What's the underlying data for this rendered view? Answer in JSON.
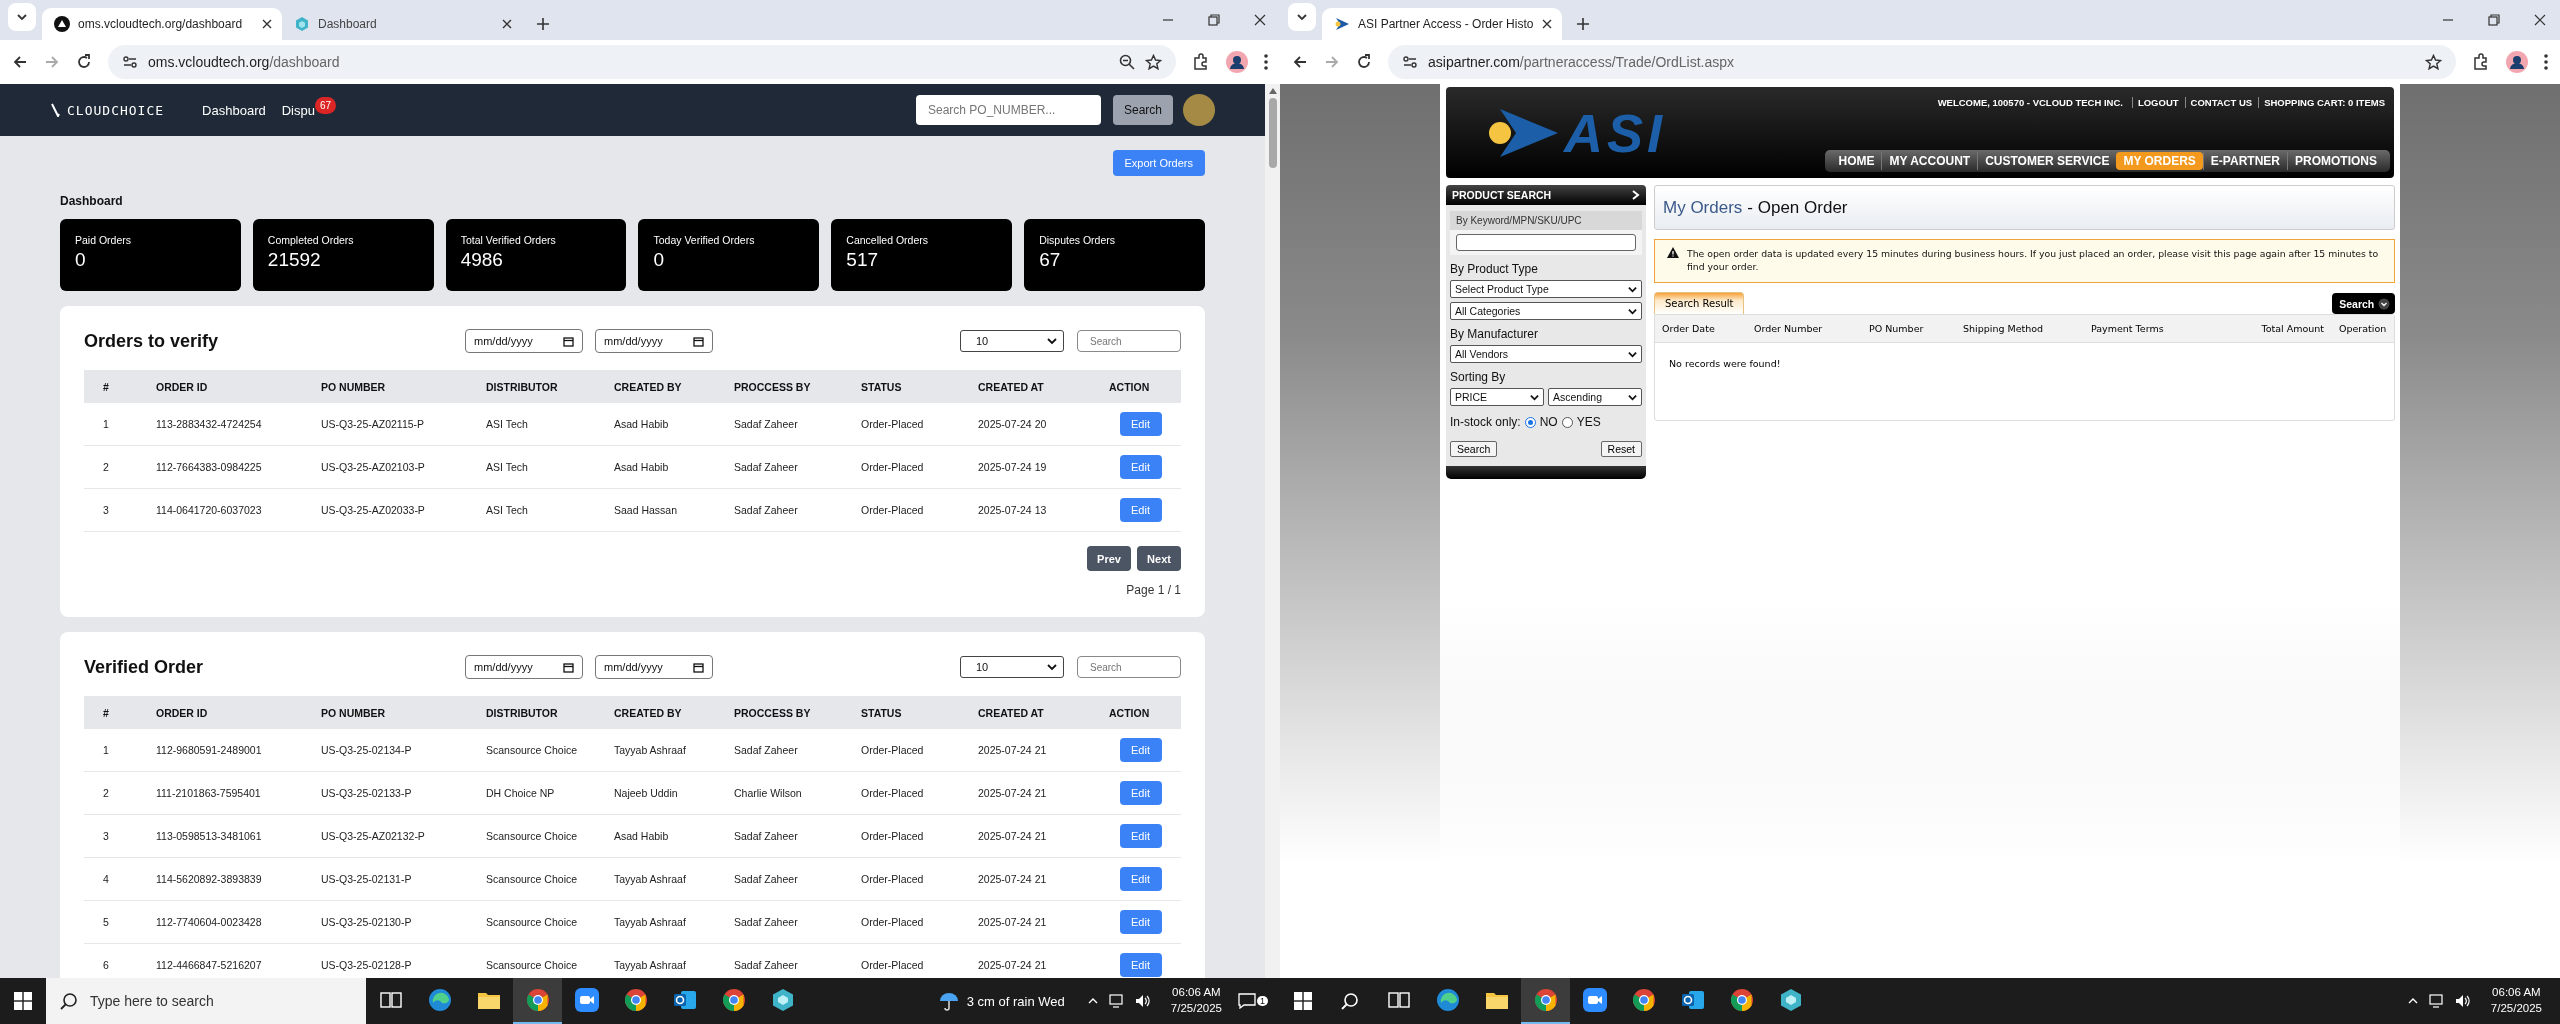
{
  "left_browser": {
    "tabs": [
      {
        "title": "oms.vcloudtech.org/dashboard",
        "kind": "triangle",
        "selected": true
      },
      {
        "title": "Dashboard",
        "kind": "hexagon",
        "selected": false
      }
    ],
    "address": {
      "host": "oms.vcloudtech.org",
      "path": "/dashboard"
    },
    "zoom_indicator": true,
    "page": {
      "logo": "CLOUDCHOICE",
      "nav_links": [
        {
          "label": "Dashboard"
        },
        {
          "label": "Dispu",
          "badge": "67"
        }
      ],
      "search": {
        "placeholder": "Search PO_NUMBER..."
      },
      "search_button": "Search",
      "export_button": "Export Orders",
      "heading": "Dashboard",
      "stats": [
        {
          "label": "Paid Orders",
          "value": "0"
        },
        {
          "label": "Completed Orders",
          "value": "21592"
        },
        {
          "label": "Total Verified Orders",
          "value": "4986"
        },
        {
          "label": "Today Verified Orders",
          "value": "0"
        },
        {
          "label": "Cancelled Orders",
          "value": "517"
        },
        {
          "label": "Disputes Orders",
          "value": "67"
        }
      ],
      "panels": [
        {
          "title": "Orders to verify",
          "date_fields": [
            "mm/dd/yyyy",
            "mm/dd/yyyy"
          ],
          "page_size": "10",
          "search": {
            "placeholder": "Search"
          },
          "columns": [
            "#",
            "ORDER ID",
            "PO NUMBER",
            "DISTRIBUTOR",
            "CREATED BY",
            "PROCCESS BY",
            "STATUS",
            "CREATED AT",
            "ACTION"
          ],
          "rows": [
            {
              "cells": [
                "1",
                "113-2883432-4724254",
                "US-Q3-25-AZ02115-P",
                "ASI Tech",
                "Asad Habib",
                "Sadaf Zaheer",
                "Order-Placed",
                "2025-07-24 20"
              ],
              "action": "Edit"
            },
            {
              "cells": [
                "2",
                "112-7664383-0984225",
                "US-Q3-25-AZ02103-P",
                "ASI Tech",
                "Asad Habib",
                "Sadaf Zaheer",
                "Order-Placed",
                "2025-07-24 19"
              ],
              "action": "Edit"
            },
            {
              "cells": [
                "3",
                "114-0641720-6037023",
                "US-Q3-25-AZ02033-P",
                "ASI Tech",
                "Saad Hassan",
                "Sadaf Zaheer",
                "Order-Placed",
                "2025-07-24 13"
              ],
              "action": "Edit"
            }
          ],
          "pager": {
            "prev": "Prev",
            "next": "Next",
            "status": "Page 1 / 1"
          }
        },
        {
          "title": "Verified Order",
          "date_fields": [
            "mm/dd/yyyy",
            "mm/dd/yyyy"
          ],
          "page_size": "10",
          "search": {
            "placeholder": "Search"
          },
          "columns": [
            "#",
            "ORDER ID",
            "PO NUMBER",
            "DISTRIBUTOR",
            "CREATED BY",
            "PROCCESS BY",
            "STATUS",
            "CREATED AT",
            "ACTION"
          ],
          "rows": [
            {
              "cells": [
                "1",
                "112-9680591-2489001",
                "US-Q3-25-02134-P",
                "Scansource Choice",
                "Tayyab Ashraaf",
                "Sadaf Zaheer",
                "Order-Placed",
                "2025-07-24 21"
              ],
              "action": "Edit"
            },
            {
              "cells": [
                "2",
                "111-2101863-7595401",
                "US-Q3-25-02133-P",
                "DH Choice NP",
                "Najeeb Uddin",
                "Charlie Wilson",
                "Order-Placed",
                "2025-07-24 21"
              ],
              "action": "Edit"
            },
            {
              "cells": [
                "3",
                "113-0598513-3481061",
                "US-Q3-25-AZ02132-P",
                "Scansource Choice",
                "Asad Habib",
                "Sadaf Zaheer",
                "Order-Placed",
                "2025-07-24 21"
              ],
              "action": "Edit"
            },
            {
              "cells": [
                "4",
                "114-5620892-3893839",
                "US-Q3-25-02131-P",
                "Scansource Choice",
                "Tayyab Ashraaf",
                "Sadaf Zaheer",
                "Order-Placed",
                "2025-07-24 21"
              ],
              "action": "Edit"
            },
            {
              "cells": [
                "5",
                "112-7740604-0023428",
                "US-Q3-25-02130-P",
                "Scansource Choice",
                "Tayyab Ashraaf",
                "Sadaf Zaheer",
                "Order-Placed",
                "2025-07-24 21"
              ],
              "action": "Edit"
            },
            {
              "cells": [
                "6",
                "112-4466847-5216207",
                "US-Q3-25-02128-P",
                "Scansource Choice",
                "Tayyab Ashraaf",
                "Sadaf Zaheer",
                "Order-Placed",
                "2025-07-24 21"
              ],
              "action": "Edit"
            }
          ]
        }
      ]
    }
  },
  "right_browser": {
    "tabs": [
      {
        "title": "ASI Partner Access - Order Histo",
        "kind": "arrow",
        "selected": true
      }
    ],
    "address": {
      "host": "asipartner.com",
      "path": "/partneraccess/Trade/OrdList.aspx"
    },
    "zoom_indicator": false,
    "page": {
      "welcome": "WELCOME, 100570 - VCLOUD TECH INC.",
      "top_links": [
        "LOGOUT",
        "CONTACT US",
        "SHOPPING CART: 0 ITEMS"
      ],
      "logo": "ASI",
      "nav": [
        {
          "label": "HOME",
          "selected": false
        },
        {
          "label": "MY ACCOUNT",
          "selected": false
        },
        {
          "label": "CUSTOMER SERVICE",
          "selected": false
        },
        {
          "label": "MY ORDERS",
          "selected": true
        },
        {
          "label": "E-PARTNER",
          "selected": false
        },
        {
          "label": "PROMOTIONS",
          "selected": false
        }
      ],
      "sidebar": {
        "title": "PRODUCT SEARCH",
        "keyword_label": "By Keyword/MPN/SKU/UPC",
        "product_type_label": "By Product Type",
        "product_type": "Select Product Type",
        "category": "All Categories",
        "manufacturer_label": "By Manufacturer",
        "manufacturer": "All Vendors",
        "sort_label": "Sorting By",
        "sort_field": "PRICE",
        "sort_order": "Ascending",
        "stock_label": "In-stock only:",
        "stock_options": [
          {
            "label": "NO",
            "selected": true
          },
          {
            "label": "YES",
            "selected": false
          }
        ],
        "buttons": [
          "Search",
          "Reset"
        ]
      },
      "main": {
        "title": "My Orders",
        "subtitle": "- Open Order",
        "notice": "The open order data is updated every 15 minutes during business hours. If you just placed an order, please visit this page again after 15 minutes to find your order.",
        "tabs": [
          {
            "label": "Search Result",
            "selected": true
          }
        ],
        "search_button": "Search",
        "columns": [
          "Order Date",
          "Order Number",
          "PO Number",
          "Shipping Method",
          "Payment Terms",
          "Total Amount",
          "Operation"
        ],
        "empty_message": "No records were found!"
      }
    }
  },
  "left_taskbar": {
    "search": {
      "kind": "box",
      "placeholder": "Type here to search"
    },
    "apps": [
      {
        "kind": "taskview",
        "active": false
      },
      {
        "kind": "edge",
        "active": false
      },
      {
        "kind": "explorer",
        "active": false
      },
      {
        "kind": "chrome",
        "active": true
      },
      {
        "kind": "zoom",
        "active": false
      },
      {
        "kind": "chrome",
        "active": false
      },
      {
        "kind": "outlook",
        "active": false
      },
      {
        "kind": "chrome",
        "active": false
      },
      {
        "kind": "hexapp",
        "active": false
      }
    ],
    "weather": "3 cm of rain Wed",
    "time": "06:06 AM",
    "date": "7/25/2025",
    "notifications": "1"
  },
  "right_taskbar": {
    "search": {
      "kind": "icon"
    },
    "apps": [
      {
        "kind": "taskview",
        "active": false
      },
      {
        "kind": "edge",
        "active": false
      },
      {
        "kind": "explorer",
        "active": false
      },
      {
        "kind": "chrome",
        "active": true
      },
      {
        "kind": "zoom",
        "active": false
      },
      {
        "kind": "chrome",
        "active": false
      },
      {
        "kind": "outlook",
        "active": false
      },
      {
        "kind": "chrome",
        "active": false
      },
      {
        "kind": "hexapp",
        "active": false
      }
    ],
    "time": "06:06 AM",
    "date": "7/25/2025"
  }
}
